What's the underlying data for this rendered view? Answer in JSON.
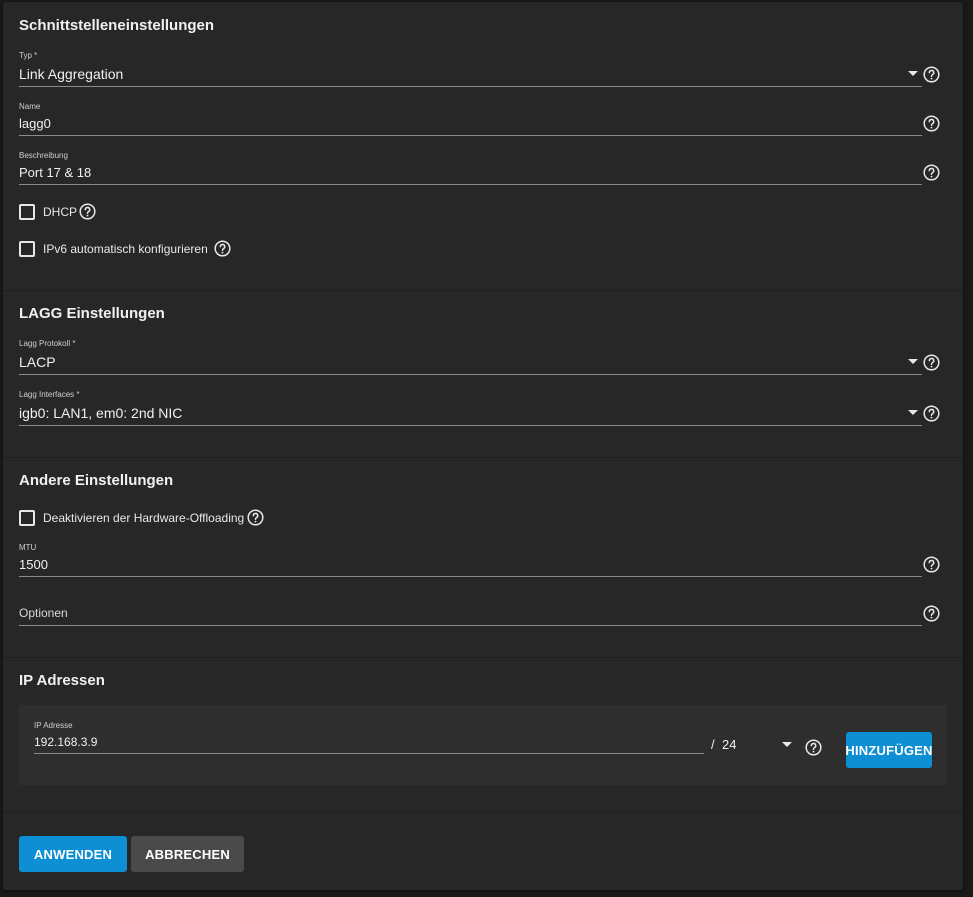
{
  "interface_settings": {
    "title": "Schnittstelleneinstellungen",
    "type": {
      "label": "Typ *",
      "value": "Link Aggregation"
    },
    "name": {
      "label": "Name",
      "value": "lagg0"
    },
    "description": {
      "label": "Beschreibung",
      "value": "Port 17 & 18"
    },
    "dhcp": {
      "label": "DHCP",
      "checked": false
    },
    "ipv6": {
      "label": "IPv6 automatisch konfigurieren",
      "checked": false
    }
  },
  "lagg_settings": {
    "title": "LAGG Einstellungen",
    "protocol": {
      "label": "Lagg Protokoll *",
      "value": "LACP"
    },
    "interfaces": {
      "label": "Lagg Interfaces *",
      "value": "igb0: LAN1, em0: 2nd NIC"
    }
  },
  "other_settings": {
    "title": "Andere Einstellungen",
    "disable_offloading": {
      "label": "Deaktivieren der Hardware-Offloading",
      "checked": false
    },
    "mtu": {
      "label": "MTU",
      "value": "1500"
    },
    "options": {
      "placeholder": "Optionen"
    }
  },
  "ip_addresses": {
    "title": "IP Adressen",
    "address": {
      "label": "IP Adresse",
      "value": "192.168.3.9"
    },
    "separator": "/",
    "netmask": "24",
    "add_button": "HINZUFÜGEN"
  },
  "actions": {
    "apply": "ANWENDEN",
    "cancel": "ABBRECHEN"
  },
  "colors": {
    "primary": "#0e8ed3",
    "secondary": "#4a4a4a",
    "card": "#272727",
    "background": "#1a1a1a"
  },
  "icons": [
    "help-circle-icon",
    "dropdown-arrow-icon",
    "checkbox-icon"
  ]
}
